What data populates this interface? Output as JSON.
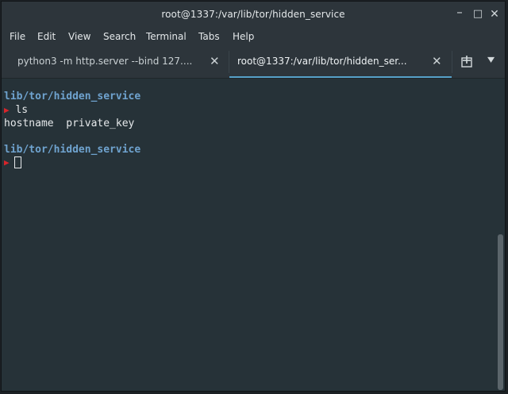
{
  "window": {
    "title": "root@1337:/var/lib/tor/hidden_service",
    "controls": {
      "minimize": "–",
      "maximize": "□",
      "close": "✕"
    }
  },
  "menu": [
    "File",
    "Edit",
    "View",
    "Search",
    "Terminal",
    "Tabs",
    "Help"
  ],
  "tabs": [
    {
      "label": "python3 -m http.server --bind 127....",
      "close": "✕",
      "active": false
    },
    {
      "label": "root@1337:/var/lib/tor/hidden_ser...",
      "close": "✕",
      "active": true
    }
  ],
  "tabbar": {
    "new_tab_icon": "new-tab-icon",
    "menu_icon": "tab-menu-icon",
    "menu_glyph": "▾"
  },
  "terminal": {
    "lines": [
      {
        "type": "path",
        "text": "lib/tor/hidden_service"
      },
      {
        "type": "prompt",
        "arrow": "▶",
        "text": " ls"
      },
      {
        "type": "output",
        "text": "hostname  private_key"
      },
      {
        "type": "blank",
        "text": ""
      },
      {
        "type": "path",
        "text": "lib/tor/hidden_service"
      },
      {
        "type": "prompt",
        "arrow": "▶",
        "text": ""
      }
    ]
  },
  "colors": {
    "background": "#263238",
    "path": "#6fa3cf",
    "prompt_arrow": "#d8252b",
    "active_tab_underline": "#56a0c8"
  }
}
